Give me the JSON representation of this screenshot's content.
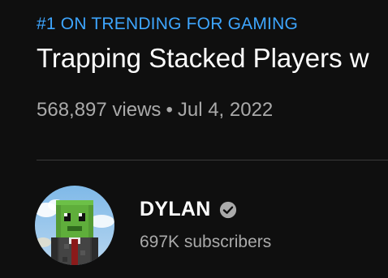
{
  "video": {
    "trending_badge": "#1 ON TRENDING FOR GAMING",
    "title": "Trapping Stacked Players w",
    "views": "568,897 views",
    "separator": "•",
    "date": "Jul 4, 2022"
  },
  "channel": {
    "name": "DYLAN",
    "subscribers": "697K subscribers",
    "avatar_icon": "minecraft-skin-avatar",
    "verified_icon": "verified-checkmark-icon"
  },
  "colors": {
    "background": "#0f0f0f",
    "trending": "#3ea6ff",
    "title": "#ffffff",
    "secondary_text": "#aaaaaa"
  }
}
